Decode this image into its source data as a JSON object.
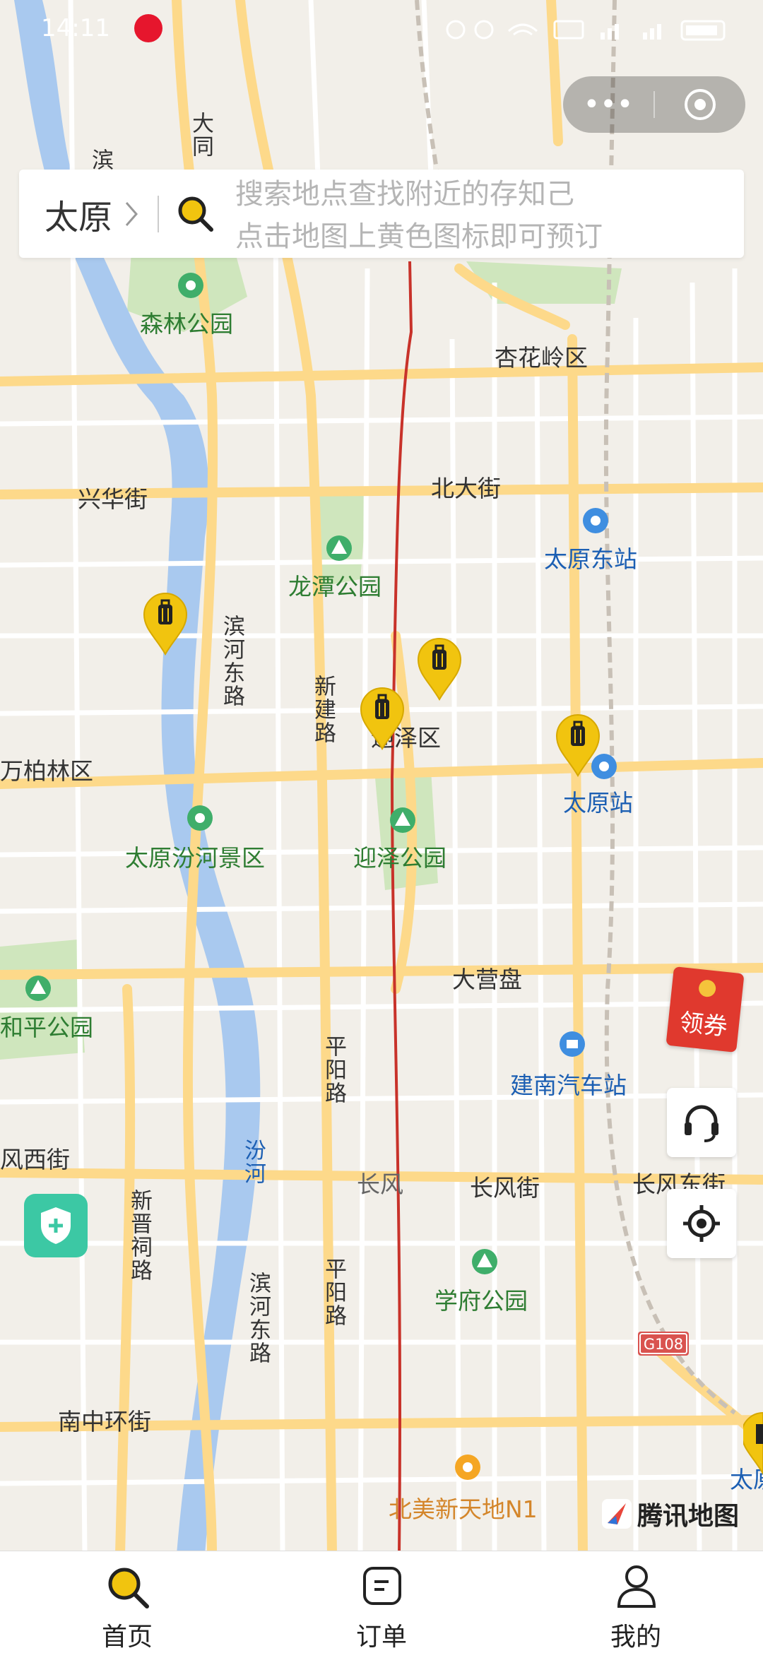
{
  "status_bar": {
    "time": "14:11"
  },
  "capsule": {
    "more_icon": "ellipsis-icon",
    "close_icon": "target-circle-icon"
  },
  "search": {
    "city": "太原",
    "placeholder_line1": "搜索地点查找附近的存知己",
    "placeholder_line2": "点击地图上黄色图标即可预订"
  },
  "map": {
    "districts": [
      {
        "name": "杏花岭区"
      },
      {
        "name": "迎泽区"
      },
      {
        "name": "万柏林区"
      }
    ],
    "streets": [
      {
        "name": "兴华街"
      },
      {
        "name": "北大街"
      },
      {
        "name": "大营盘"
      },
      {
        "name": "长风"
      },
      {
        "name": "长风街"
      },
      {
        "name": "长风东街"
      },
      {
        "name": "风西街"
      },
      {
        "name": "南中环街"
      }
    ],
    "vertical_streets": [
      {
        "name": "滨河东路"
      },
      {
        "name": "新建路"
      },
      {
        "name": "平阳路"
      },
      {
        "name": "汾河"
      },
      {
        "name": "新晋祠路"
      },
      {
        "name": "平阳路"
      },
      {
        "name": "滨河东路"
      },
      {
        "name": "大同"
      },
      {
        "name": "滨"
      }
    ],
    "pois": [
      {
        "name": "森林公园",
        "type": "scenic"
      },
      {
        "name": "龙潭公园",
        "type": "park"
      },
      {
        "name": "太原东站",
        "type": "rail"
      },
      {
        "name": "太原站",
        "type": "rail"
      },
      {
        "name": "太原汾河景区",
        "type": "scenic"
      },
      {
        "name": "迎泽公园",
        "type": "park"
      },
      {
        "name": "和平公园",
        "type": "park"
      },
      {
        "name": "建南汽车站",
        "type": "bus"
      },
      {
        "name": "学府公园",
        "type": "park"
      },
      {
        "name": "北美新天地N1",
        "type": "mall"
      },
      {
        "name": "太原",
        "type": "rail"
      }
    ],
    "road_shield": "G108",
    "pin_icon": "luggage-pin-icon",
    "watermark": "腾讯地图"
  },
  "coupon": {
    "label": "领券"
  },
  "tabs": [
    {
      "label": "首页",
      "icon": "search-icon"
    },
    {
      "label": "订单",
      "icon": "order-icon"
    },
    {
      "label": "我的",
      "icon": "user-icon"
    }
  ],
  "colors": {
    "accent_yellow": "#f1c40f",
    "river": "#a9c9ef",
    "park": "#cfe6bd",
    "road": "#fdd98a",
    "rail_red": "#c8322a"
  }
}
